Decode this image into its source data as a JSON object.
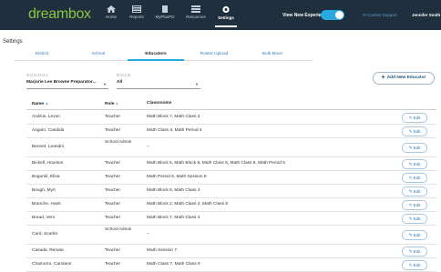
{
  "nav": {
    "logo": "dreambox",
    "items": [
      {
        "label": "Home",
        "icon": "home-icon"
      },
      {
        "label": "Reports",
        "icon": "reports-icon"
      },
      {
        "label": "MyPlusPD",
        "icon": "myplus-icon"
      },
      {
        "label": "Resources",
        "icon": "resources-icon"
      },
      {
        "label": "Settings",
        "icon": "gear-icon"
      }
    ],
    "active_item": "Settings",
    "toggle_label": "View New Experience!",
    "toggle_on": true,
    "contact_label": "Contact Support",
    "user_name": "Jennifer Smith"
  },
  "page": {
    "title": "Settings",
    "tabs": [
      "District",
      "School",
      "Educators",
      "Roster Upload",
      "Bulk Move"
    ],
    "active_tab": "Educators"
  },
  "filters": {
    "school_label": "SCHOOL",
    "school_value": "Marjorie Lee Browne Preparator...",
    "role_label": "ROLE",
    "role_value": "All"
  },
  "add_button_label": "Add New Educator",
  "table": {
    "headers": [
      "Name",
      "Role",
      "Classrooms"
    ],
    "edit_label": "Edit",
    "rows": [
      {
        "name": "Andrus, Levon",
        "role": "Teacher",
        "classrooms": "Math Block 7, Math Class 3"
      },
      {
        "name": "Angulo, Candida",
        "role": "Teacher",
        "classrooms": "Math Class 3, Math Period 4"
      },
      {
        "name": "Bennet, Leandro",
        "role": "School Admin",
        "classrooms": "--"
      },
      {
        "name": "Bickell, Houston",
        "role": "Teacher",
        "classrooms": "Math Block 6, Math Block 8, Math Class 6, Math Class 8, Math Period 5"
      },
      {
        "name": "Bogumil, Elisa",
        "role": "Teacher",
        "classrooms": "Math Period 6, Math Session 8"
      },
      {
        "name": "Bough, Myrl",
        "role": "Teacher",
        "classrooms": "Math Block 8, Math Class 4"
      },
      {
        "name": "Branche, Hank",
        "role": "Teacher",
        "classrooms": "Math Block 2, Math Class 2, Math Class 8"
      },
      {
        "name": "Bread, Vern",
        "role": "Teacher",
        "classrooms": "Math Block 7, Math Class 4"
      },
      {
        "name": "Card, Scarlet",
        "role": "School Admin",
        "classrooms": "--"
      },
      {
        "name": "Casada, Renata",
        "role": "Teacher",
        "classrooms": "Math Session 7"
      },
      {
        "name": "Chamorro, Carolann",
        "role": "Teacher",
        "classrooms": "Math Class 7, Math Class 8"
      }
    ]
  },
  "colors": {
    "nav_bg": "#1f2f3d",
    "accent": "#29a8e0",
    "logo_green": "#8cc63f",
    "link_blue": "#3a7bbf"
  }
}
